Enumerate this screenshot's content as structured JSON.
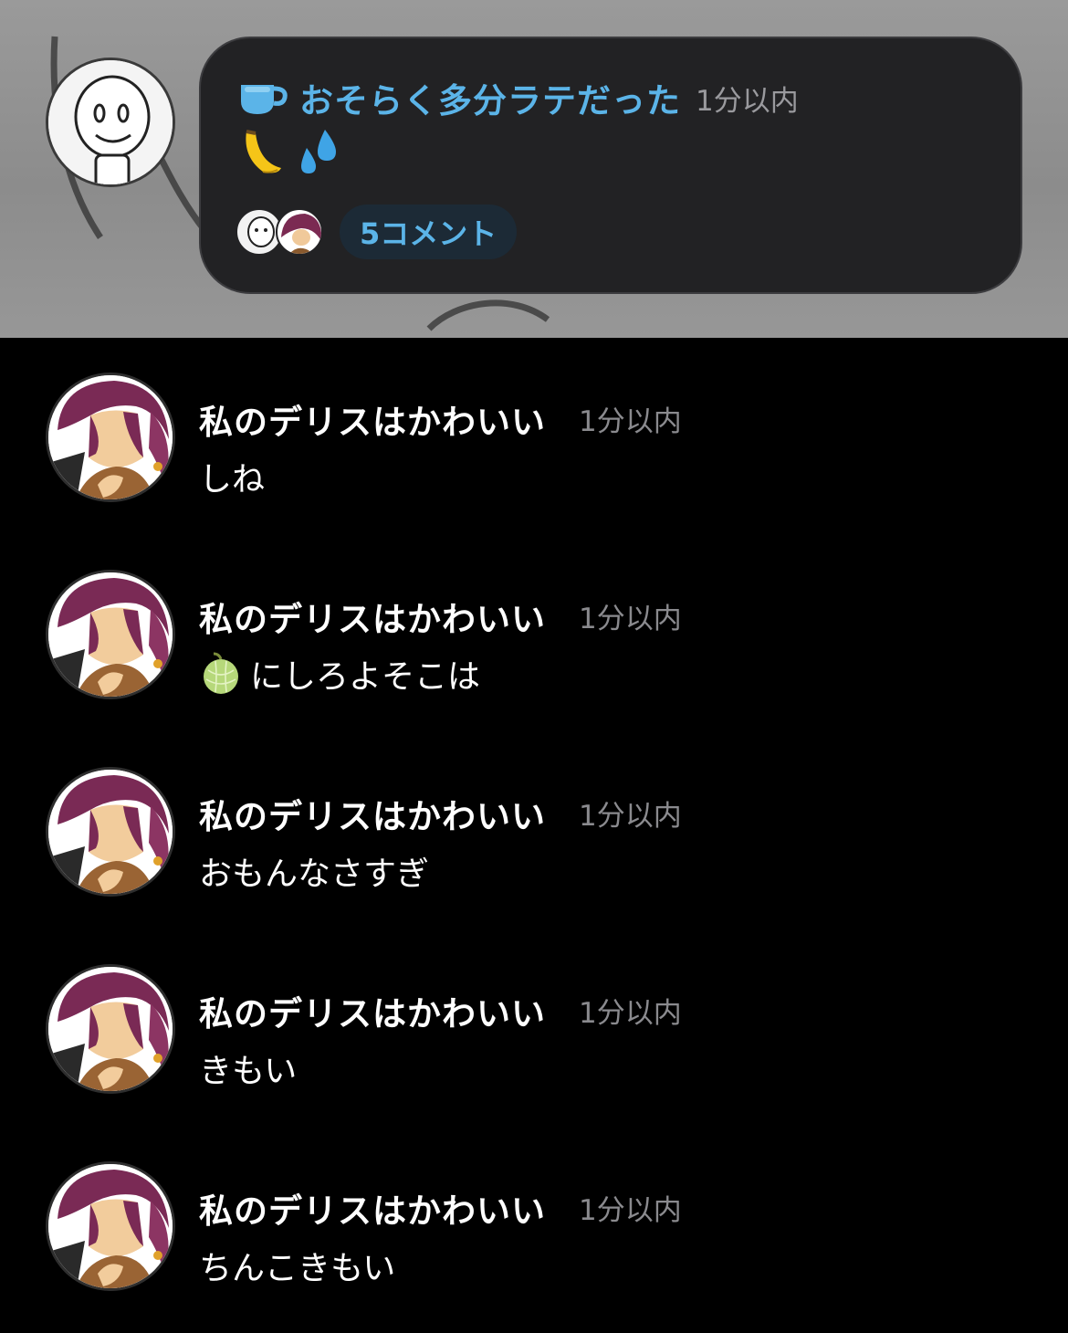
{
  "post": {
    "title": "おそらく多分ラテだった",
    "time": "1分以内",
    "icon": "coffee-cup-icon",
    "emojis": [
      "banana-icon",
      "sweat-drops-icon"
    ],
    "comment_count": "5コメント"
  },
  "comments": [
    {
      "name": "私のデリスはかわいい",
      "time": "1分以内",
      "text": "しね"
    },
    {
      "name": "私のデリスはかわいい",
      "time": "1分以内",
      "text": "にしろよそこは",
      "prefix_icon": "melon-icon"
    },
    {
      "name": "私のデリスはかわいい",
      "time": "1分以内",
      "text": "おもんなさすぎ"
    },
    {
      "name": "私のデリスはかわいい",
      "time": "1分以内",
      "text": "きもい"
    },
    {
      "name": "私のデリスはかわいい",
      "time": "1分以内",
      "text": "ちんこきもい"
    }
  ],
  "colors": {
    "accent": "#5bb4e8",
    "bubble": "#222224",
    "background": "#000000"
  }
}
